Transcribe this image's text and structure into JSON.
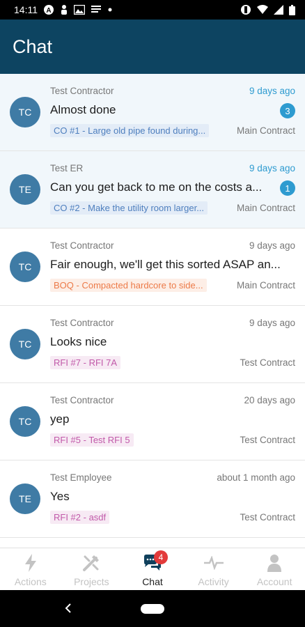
{
  "status_bar": {
    "time": "14:11",
    "icons_left": [
      "a-circle-icon",
      "person-icon",
      "photo-icon",
      "notes-icon",
      "dot-icon"
    ],
    "icons_right": [
      "vibrate-icon",
      "wifi-icon",
      "signal-icon",
      "battery-icon"
    ]
  },
  "header": {
    "title": "Chat",
    "background": "#0d4461"
  },
  "conversations": [
    {
      "initials": "TC",
      "sender": "Test Contractor",
      "time": "9 days ago",
      "message": "Almost done",
      "unread": "3",
      "tag": "CO #1 - Large old pipe found during...",
      "tag_type": "co",
      "contract": "Main Contract"
    },
    {
      "initials": "TE",
      "sender": "Test ER",
      "time": "9 days ago",
      "message": "Can you get back to me on the costs a...",
      "unread": "1",
      "tag": "CO #2 - Make the utility room larger...",
      "tag_type": "co",
      "contract": "Main Contract"
    },
    {
      "initials": "TC",
      "sender": "Test Contractor",
      "time": "9 days ago",
      "message": "Fair enough, we'll get this sorted ASAP an...",
      "unread": "",
      "tag": "BOQ - Compacted hardcore to side...",
      "tag_type": "boq",
      "contract": "Main Contract"
    },
    {
      "initials": "TC",
      "sender": "Test Contractor",
      "time": "9 days ago",
      "message": "Looks nice",
      "unread": "",
      "tag": "RFI #7 - RFI 7A",
      "tag_type": "rfi",
      "contract": "Test Contract"
    },
    {
      "initials": "TC",
      "sender": "Test Contractor",
      "time": "20 days ago",
      "message": "yep",
      "unread": "",
      "tag": "RFI #5 - Test RFI 5",
      "tag_type": "rfi",
      "contract": "Test Contract"
    },
    {
      "initials": "TE",
      "sender": "Test Employee",
      "time": "about 1 month ago",
      "message": "Yes",
      "unread": "",
      "tag": "RFI #2 - asdf",
      "tag_type": "rfi",
      "contract": "Test Contract"
    }
  ],
  "bottom_nav": {
    "items": [
      {
        "label": "Actions",
        "icon": "lightning-icon",
        "active": false
      },
      {
        "label": "Projects",
        "icon": "tools-icon",
        "active": false
      },
      {
        "label": "Chat",
        "icon": "chat-bubbles-icon",
        "active": true,
        "badge": "4"
      },
      {
        "label": "Activity",
        "icon": "pulse-icon",
        "active": false
      },
      {
        "label": "Account",
        "icon": "person-icon",
        "active": false
      }
    ]
  },
  "colors": {
    "accent": "#2e9bd0",
    "avatar": "#3f7ba5",
    "badge_red": "#e33b3b",
    "tag_co": "#4e7fbe",
    "tag_boq": "#ec7a48",
    "tag_rfi": "#c159a9"
  }
}
